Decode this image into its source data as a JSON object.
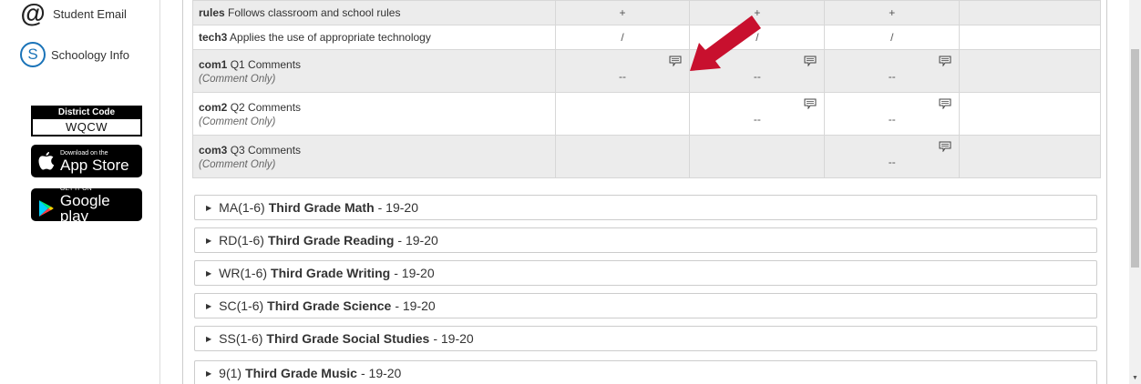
{
  "sidebar": {
    "email_label": "Student Email",
    "schoology_label": "Schoology Info",
    "district_header": "District Code",
    "district_code": "WQCW",
    "appstore_small": "Download on the",
    "appstore_big": "App Store",
    "googleplay_small": "GET IT ON",
    "googleplay_big": "Google play"
  },
  "table": {
    "rows": [
      {
        "code": "rules",
        "desc": "Follows classroom and school rules",
        "sub": "",
        "q1": "+",
        "q2": "+",
        "q3": "+"
      },
      {
        "code": "tech3",
        "desc": "Applies the use of appropriate technology",
        "sub": "",
        "q1": "/",
        "q2": "/",
        "q3": "/"
      },
      {
        "code": "com1",
        "desc": "Q1 Comments",
        "sub": "(Comment Only)",
        "q1": "--",
        "q2": "--",
        "q3": "--"
      },
      {
        "code": "com2",
        "desc": "Q2 Comments",
        "sub": "(Comment Only)",
        "q2": "--",
        "q3": "--"
      },
      {
        "code": "com3",
        "desc": "Q3 Comments",
        "sub": "(Comment Only)",
        "q3": "--"
      }
    ]
  },
  "sections": [
    {
      "code": "MA(1-6)",
      "title": "Third Grade Math",
      "year": "- 19-20"
    },
    {
      "code": "RD(1-6)",
      "title": "Third Grade Reading",
      "year": "- 19-20"
    },
    {
      "code": "WR(1-6)",
      "title": "Third Grade Writing",
      "year": "- 19-20"
    },
    {
      "code": "SC(1-6)",
      "title": "Third Grade Science",
      "year": "- 19-20"
    },
    {
      "code": "SS(1-6)",
      "title": "Third Grade Social Studies",
      "year": "- 19-20"
    },
    {
      "code": "9(1)",
      "title": "Third Grade Music",
      "year": "- 19-20"
    }
  ],
  "colors": {
    "arrow": "#c8102e",
    "schoology_blue": "#1a73b8"
  }
}
